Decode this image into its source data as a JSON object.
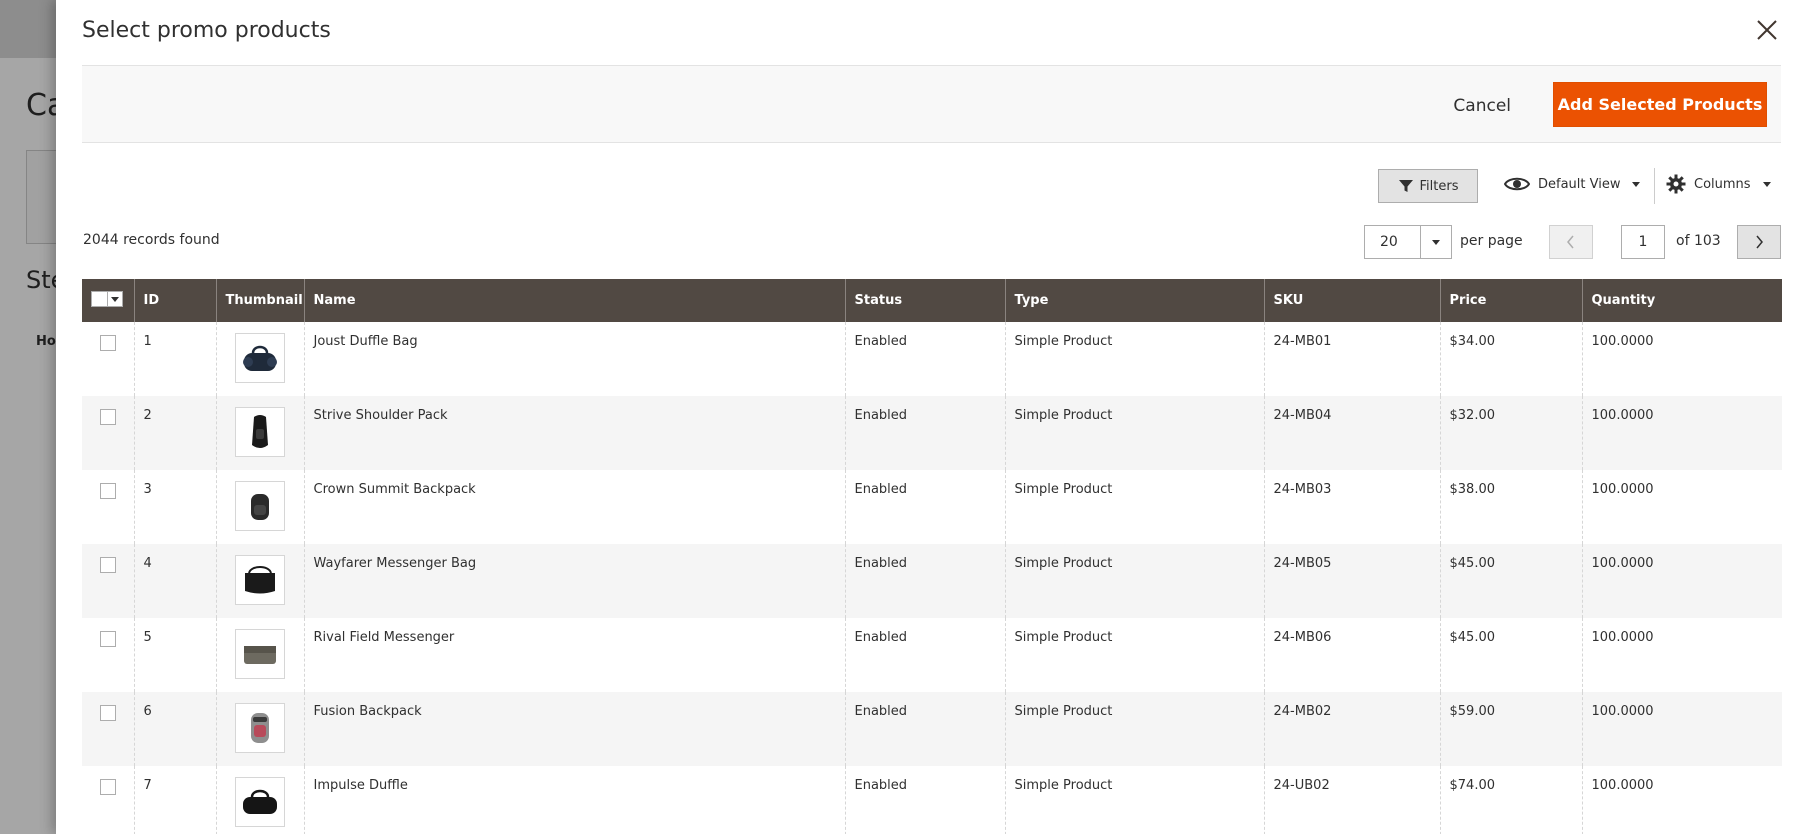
{
  "background": {
    "title": "Ca",
    "step": "Ste",
    "how": "Ho"
  },
  "modal": {
    "title": "Select promo products",
    "cancel_label": "Cancel",
    "add_label": "Add Selected Products"
  },
  "toolbar": {
    "filters_label": "Filters",
    "view_label": "Default View",
    "columns_label": "Columns",
    "records_found": "2044 records found",
    "per_page_value": "20",
    "per_page_label": "per page",
    "current_page": "1",
    "page_total_label": "of 103"
  },
  "grid": {
    "columns": [
      "ID",
      "Thumbnail",
      "Name",
      "Status",
      "Type",
      "SKU",
      "Price",
      "Quantity"
    ],
    "rows": [
      {
        "id": "1",
        "name": "Joust Duffle Bag",
        "status": "Enabled",
        "type": "Simple Product",
        "sku": "24-MB01",
        "price": "$34.00",
        "qty": "100.0000",
        "thumb": "duffle-bag"
      },
      {
        "id": "2",
        "name": "Strive Shoulder Pack",
        "status": "Enabled",
        "type": "Simple Product",
        "sku": "24-MB04",
        "price": "$32.00",
        "qty": "100.0000",
        "thumb": "shoulder-pack"
      },
      {
        "id": "3",
        "name": "Crown Summit Backpack",
        "status": "Enabled",
        "type": "Simple Product",
        "sku": "24-MB03",
        "price": "$38.00",
        "qty": "100.0000",
        "thumb": "backpack"
      },
      {
        "id": "4",
        "name": "Wayfarer Messenger Bag",
        "status": "Enabled",
        "type": "Simple Product",
        "sku": "24-MB05",
        "price": "$45.00",
        "qty": "100.0000",
        "thumb": "messenger-bag"
      },
      {
        "id": "5",
        "name": "Rival Field Messenger",
        "status": "Enabled",
        "type": "Simple Product",
        "sku": "24-MB06",
        "price": "$45.00",
        "qty": "100.0000",
        "thumb": "field-messenger"
      },
      {
        "id": "6",
        "name": "Fusion Backpack",
        "status": "Enabled",
        "type": "Simple Product",
        "sku": "24-MB02",
        "price": "$59.00",
        "qty": "100.0000",
        "thumb": "fusion-backpack"
      },
      {
        "id": "7",
        "name": "Impulse Duffle",
        "status": "Enabled",
        "type": "Simple Product",
        "sku": "24-UB02",
        "price": "$74.00",
        "qty": "100.0000",
        "thumb": "duffle"
      }
    ]
  },
  "colors": {
    "accent": "#eb5202",
    "grid_header": "#514943"
  }
}
